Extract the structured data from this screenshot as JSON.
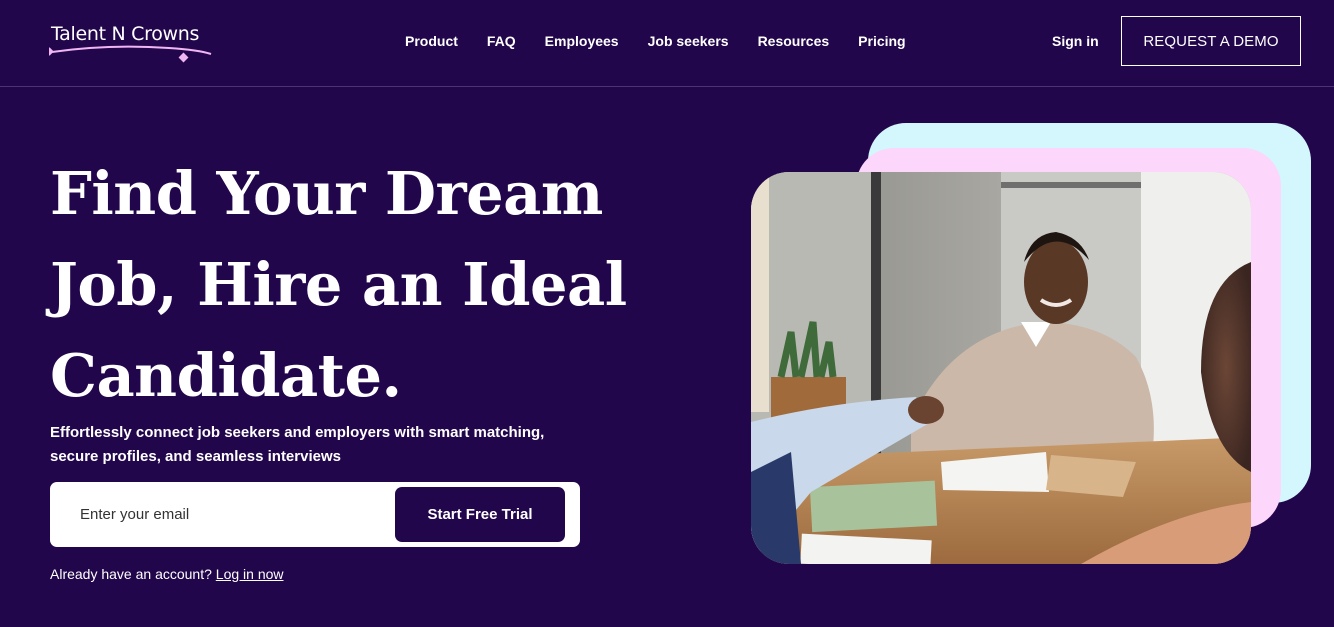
{
  "brand": {
    "name": "Talent N Crowns"
  },
  "nav": {
    "items": [
      {
        "label": "Product"
      },
      {
        "label": "FAQ"
      },
      {
        "label": "Employees"
      },
      {
        "label": "Job seekers"
      },
      {
        "label": "Resources"
      },
      {
        "label": "Pricing"
      }
    ],
    "sign_in": "Sign in",
    "demo_button": "REQUEST A DEMO"
  },
  "hero": {
    "title_lines": [
      "Find Your Dream",
      "Job, Hire an Ideal",
      "Candidate."
    ],
    "subtitle": "Effortlessly connect job seekers and employers with smart matching, secure profiles, and seamless interviews",
    "email_placeholder": "Enter your email",
    "cta_button": "Start Free Trial",
    "login_prompt": "Already have an account?",
    "login_link": "Log in now"
  },
  "colors": {
    "background": "#22064b",
    "card_cyan": "#d4f7fd",
    "card_pink": "#fcd6fb",
    "logo_accent": "#f0b6f4"
  },
  "image": {
    "subject": "job-interview-handshake-photo"
  }
}
